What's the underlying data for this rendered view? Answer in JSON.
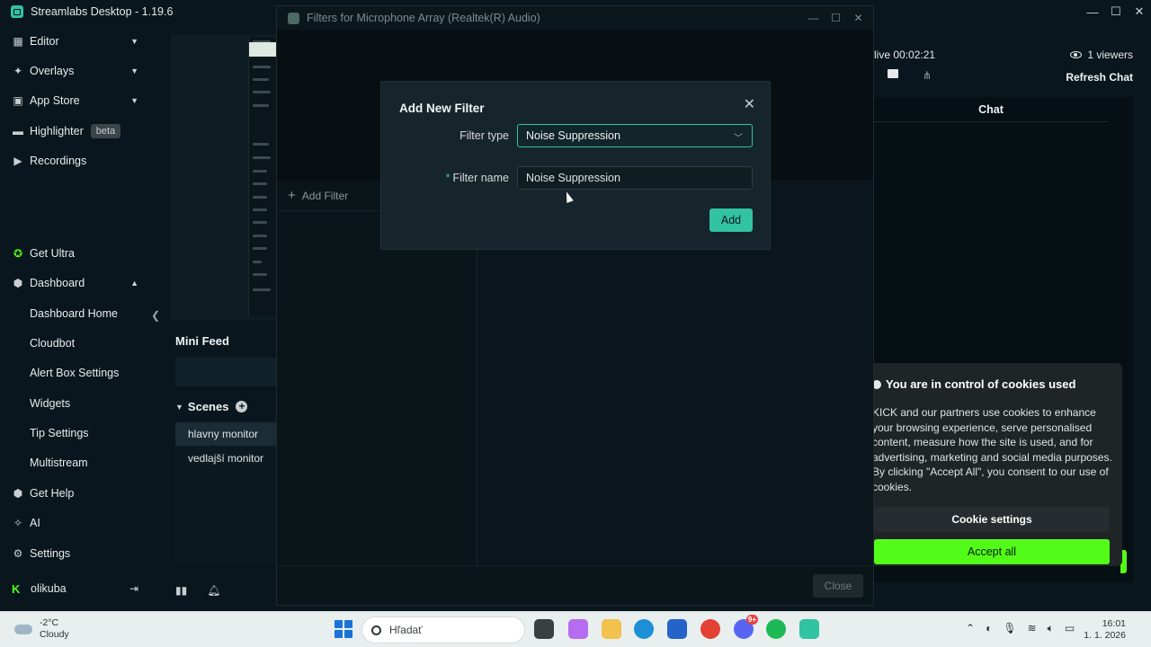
{
  "app": {
    "title": "Streamlabs Desktop - 1.19.6",
    "controls": [
      "minimize-icon",
      "maximize-icon",
      "close-icon"
    ]
  },
  "sidebar": {
    "items": [
      {
        "label": "Editor",
        "icon": "editor-icon",
        "expandable": true
      },
      {
        "label": "Overlays",
        "icon": "overlays-icon",
        "expandable": true
      },
      {
        "label": "App Store",
        "icon": "store-icon",
        "expandable": true
      },
      {
        "label": "Highlighter",
        "icon": "highlighter-icon",
        "badge": "beta"
      },
      {
        "label": "Recordings",
        "icon": "recordings-icon"
      },
      {
        "label": "Get Ultra",
        "icon": "ultra-icon"
      },
      {
        "label": "Dashboard",
        "icon": "dashboard-icon",
        "expanded": true
      },
      {
        "label": "Dashboard Home",
        "sub": true
      },
      {
        "label": "Cloudbot",
        "sub": true
      },
      {
        "label": "Alert Box Settings",
        "sub": true
      },
      {
        "label": "Widgets",
        "sub": true
      },
      {
        "label": "Tip Settings",
        "sub": true
      },
      {
        "label": "Multistream",
        "sub": true
      },
      {
        "label": "Get Help",
        "icon": "help-icon"
      },
      {
        "label": "AI",
        "icon": "ai-icon"
      },
      {
        "label": "Settings",
        "icon": "gear-icon"
      }
    ],
    "profile": {
      "name": "olikuba",
      "platform_icon": "kick-icon"
    }
  },
  "middle": {
    "mini_feed_title": "Mini Feed",
    "scenes_title": "Scenes",
    "scenes": [
      {
        "name": "hlavny monitor",
        "active": true
      },
      {
        "name": "vedlajší monitor",
        "active": false
      }
    ]
  },
  "right": {
    "live_time": "live 00:02:21",
    "viewers": "1 viewers",
    "refresh_chat": "Refresh Chat",
    "chat_tab": "Chat",
    "cookie": {
      "title": "You are in control of cookies used",
      "body": "KICK and our partners use cookies to enhance your browsing experience, serve personalised content, measure how the site is used, and for advertising, marketing and social media purposes. By clicking \"Accept All\", you consent to our use of cookies.",
      "settings_label": "Cookie settings",
      "accept_label": "Accept all"
    }
  },
  "filters_window": {
    "title": "Filters for Microphone Array (Realtek(R) Audio)",
    "add_filter": "Add Filter",
    "close_label": "Close"
  },
  "dialog": {
    "title": "Add New Filter",
    "filter_type_label": "Filter type",
    "filter_type_value": "Noise Suppression",
    "filter_name_label": "Filter name",
    "filter_name_value": "Noise Suppression",
    "add_label": "Add"
  },
  "taskbar": {
    "weather_temp": "-2°C",
    "weather_desc": "Cloudy",
    "search_placeholder": "Hľadať",
    "time": "16:01",
    "date": "1. 1. 2026",
    "discord_badge": "9+"
  },
  "colors": {
    "accent": "#31c3a2",
    "kick_green": "#53fc18",
    "background": "#09161d"
  }
}
